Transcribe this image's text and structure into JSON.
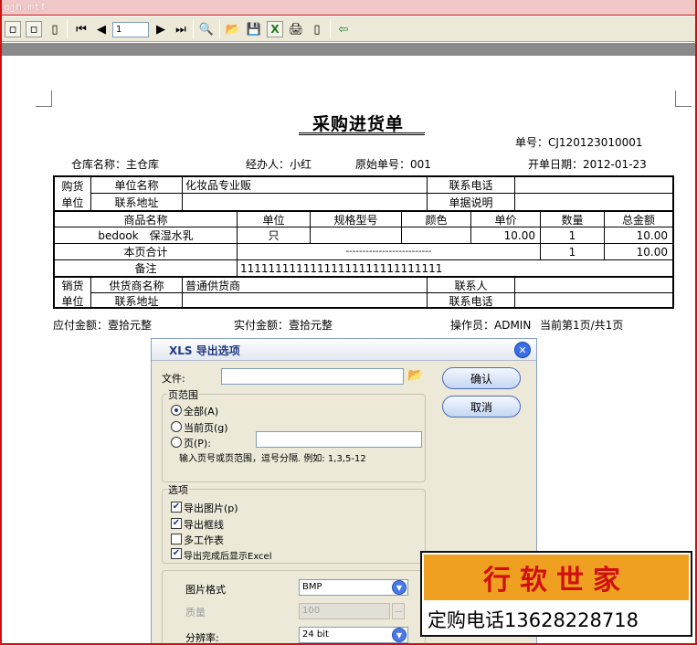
{
  "window": {
    "title": "gjh.mtf"
  },
  "toolbar": {
    "page_number": "1"
  },
  "report": {
    "title": "采购进货单",
    "doc_no": "单号：CJ120123010001",
    "warehouse": "仓库名称：主仓库",
    "handler": "经办人：小红",
    "original_no": "原始单号：001",
    "date": "开单日期：2012-01-23",
    "buyer": {
      "group1": "购货",
      "group2": "单位",
      "unit_name_label": "单位名称",
      "unit_name_value": "化妆品专业贩",
      "phone_label": "联系电话",
      "phone_value": "",
      "address_label": "联系地址",
      "address_value": "",
      "memo_label": "单据说明",
      "memo_value": ""
    },
    "columns": [
      "商品名称",
      "单位",
      "规格型号",
      "颜色",
      "单价",
      "数量",
      "总金额"
    ],
    "rows": [
      [
        "bedook　保湿水乳",
        "只",
        "",
        "",
        "10.00",
        "1",
        "10.00"
      ]
    ],
    "subtotal_label": "本页合计",
    "subtotal_dashes": "--------------------------",
    "subtotal_qty": "1",
    "subtotal_amount": "10.00",
    "remarks_label": "备注",
    "remarks_value": "11111111111111111111111111111",
    "seller": {
      "group1": "销货",
      "group2": "单位",
      "supplier_label": "供货商名称",
      "supplier_value": "普通供货商",
      "contact_label": "联系人",
      "contact_value": "",
      "address_label": "联系地址",
      "address_value": "",
      "phone_label": "联系电话",
      "phone_value": ""
    },
    "payable": "应付金额：壹拾元整",
    "paid": "实付金额：壹拾元整",
    "operator": "操作员：ADMIN",
    "page_info": "当前第1页/共1页"
  },
  "dialog": {
    "title": "XLS 导出选项",
    "file_label": "文件:",
    "file_value": "",
    "ok_label": "确认",
    "cancel_label": "取消",
    "range_group": "页范围",
    "range_all": "全部(A)",
    "range_current": "当前页(g)",
    "range_pages": "页(P):",
    "range_pages_value": "",
    "range_hint": "输入页号或页范围，逗号分隔. 例如: 1,3,5-12",
    "options_group": "选项",
    "opt_export_images": "导出图片(p)",
    "opt_export_frames": "导出框线",
    "opt_multi_sheet": "多工作表",
    "opt_open_excel": "导出完成后显示Excel",
    "image_format_label": "图片格式",
    "image_format_value": "BMP",
    "quality_label": "质量",
    "quality_value": "100",
    "resolution_label": "分辨率:",
    "resolution_value": "24 bit"
  },
  "ad": {
    "brand": "行软世家",
    "phone": "定购电话13628228718"
  },
  "colors": {
    "frame": "#d01010",
    "dialog_title": "#203a80",
    "ad_bg": "#f0a020",
    "ad_text": "#d01010"
  }
}
